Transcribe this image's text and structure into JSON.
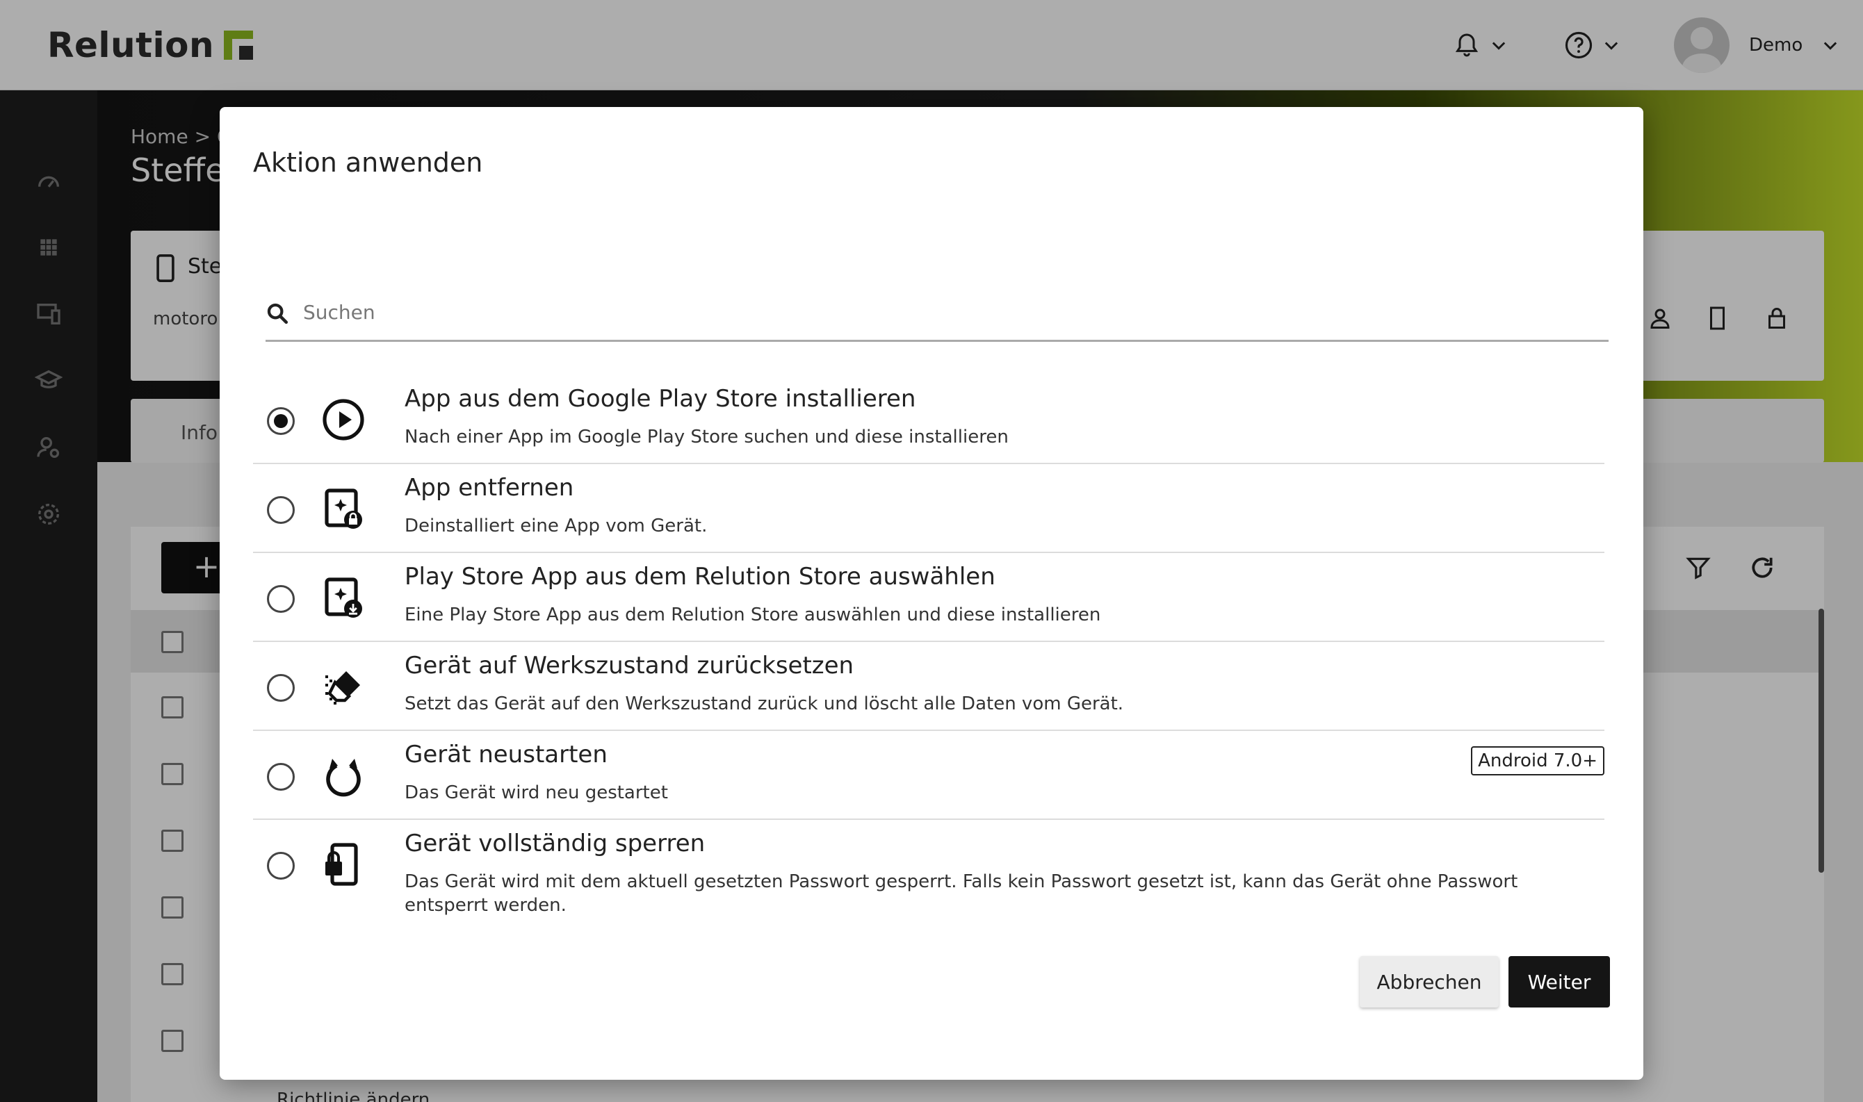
{
  "app": {
    "logo_text": "Relution",
    "user_name": "Demo",
    "brand_color": "#8db81f"
  },
  "background": {
    "breadcrumb": "Home  >  C",
    "page_title": "Steffen",
    "device_name": "Ste",
    "device_sub": "motoro",
    "tab_info": "Info",
    "add_label": "+",
    "bottom_row_text": "Richtlinie ändern"
  },
  "dialog": {
    "title": "Aktion anwenden",
    "search": {
      "placeholder": "Suchen",
      "value": ""
    },
    "options": [
      {
        "title": "App aus dem Google Play Store installieren",
        "desc": "Nach einer App im Google Play Store suchen und diese installieren",
        "icon": "play-circle-icon",
        "selected": true
      },
      {
        "title": "App entfernen",
        "desc": "Deinstalliert eine App vom Gerät.",
        "icon": "app-remove-icon",
        "selected": false
      },
      {
        "title": "Play Store App aus dem Relution Store auswählen",
        "desc": "Eine Play Store App aus dem Relution Store auswählen und diese installieren",
        "icon": "app-download-icon",
        "selected": false
      },
      {
        "title": "Gerät auf Werkszustand zurücksetzen",
        "desc": "Setzt das Gerät auf den Werkszustand zurück und löscht alle Daten vom Gerät.",
        "icon": "eraser-icon",
        "selected": false
      },
      {
        "title": "Gerät neustarten",
        "desc": "Das Gerät wird neu gestartet",
        "icon": "restart-icon",
        "selected": false,
        "badge": "Android 7.0+"
      },
      {
        "title": "Gerät vollständig sperren",
        "desc": "Das Gerät wird mit dem aktuell gesetzten Passwort gesperrt. Falls kein Passwort gesetzt ist, kann das Gerät ohne Passwort entsperrt werden.",
        "icon": "device-lock-icon",
        "selected": false
      }
    ],
    "cancel_label": "Abbrechen",
    "next_label": "Weiter"
  }
}
